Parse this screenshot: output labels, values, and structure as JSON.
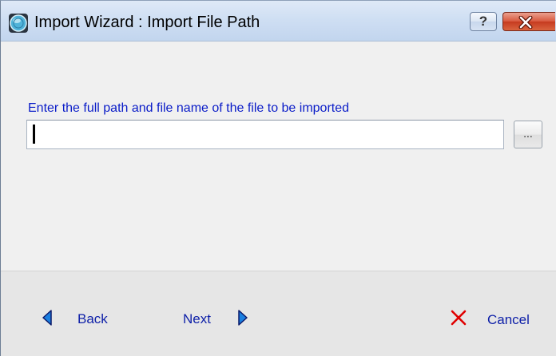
{
  "window": {
    "title": "Import Wizard : Import File Path",
    "help_label": "?"
  },
  "main": {
    "prompt": "Enter the full path and file name of the file to be imported",
    "path_value": "",
    "browse_label": "..."
  },
  "footer": {
    "back_label": "Back",
    "next_label": "Next",
    "cancel_label": "Cancel"
  },
  "icons": {
    "app": "globe-icon",
    "help": "question-icon",
    "close": "close-icon",
    "back": "triangle-left-icon",
    "next": "triangle-right-icon",
    "cancel": "red-x-icon"
  },
  "colors": {
    "label_text": "#0a1cc8",
    "nav_text": "#0d1fa8",
    "cancel_icon": "#e00000",
    "arrow_fill": "#1a7fe0",
    "close_button": "#c63a1f"
  }
}
